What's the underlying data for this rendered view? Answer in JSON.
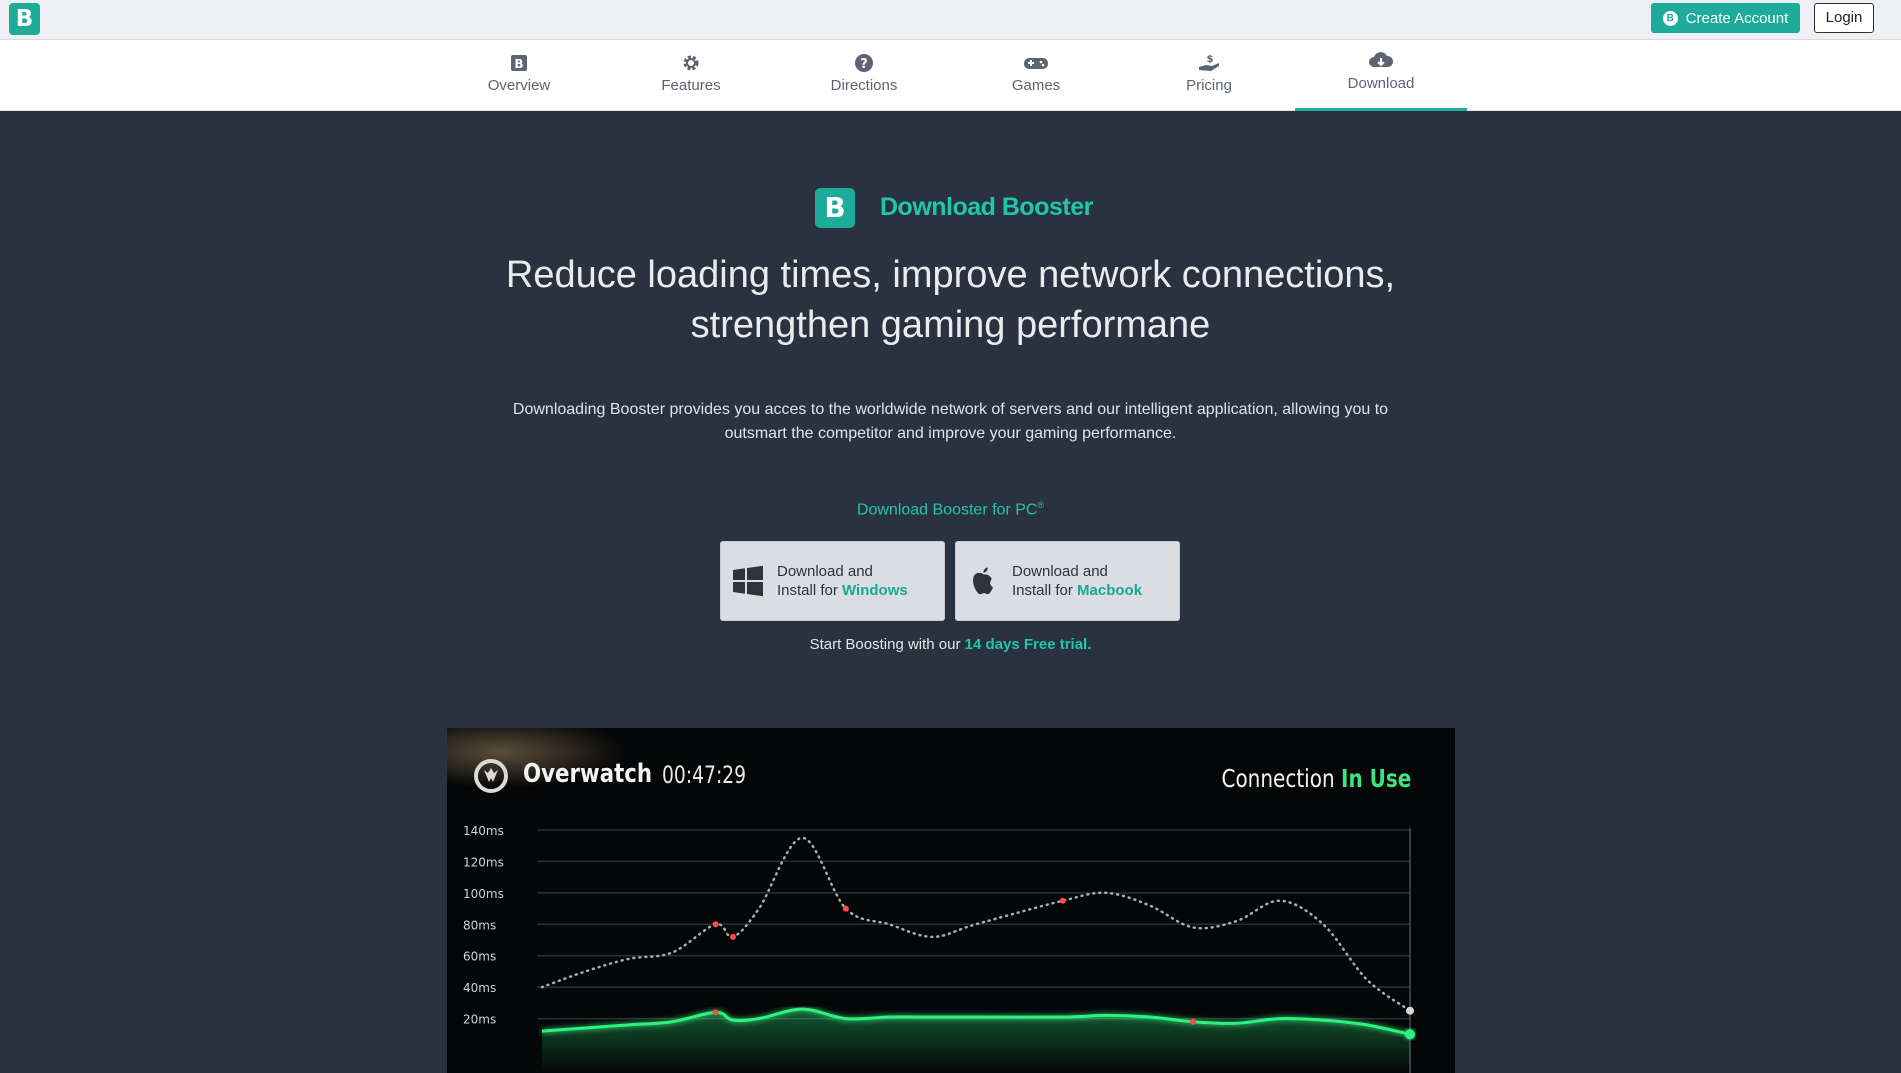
{
  "topbar": {
    "logo_letter": "B",
    "create_account": "Create Account",
    "login": "Login"
  },
  "nav": {
    "items": [
      {
        "label": "Overview",
        "icon": "b-logo-icon"
      },
      {
        "label": "Features",
        "icon": "gear-icon"
      },
      {
        "label": "Directions",
        "icon": "question-icon"
      },
      {
        "label": "Games",
        "icon": "gamepad-icon"
      },
      {
        "label": "Pricing",
        "icon": "dollar-hand-icon"
      },
      {
        "label": "Download",
        "icon": "cloud-download-icon"
      }
    ],
    "active": "Download"
  },
  "hero": {
    "logo_letter": "B",
    "brand": "Download Booster",
    "headline_line1": "Reduce loading times, improve network connections,",
    "headline_line2": "strengthen gaming performane",
    "description": "Downloading Booster provides you acces to the worldwide network of servers and our intelligent application, allowing you to outsmart the competitor and improve your gaming performance.",
    "download_title": "Download Booster for PC",
    "download_title_mark": "®"
  },
  "downloads": {
    "windows": {
      "line1": "Download and",
      "line2_prefix": "Install for ",
      "os": "Windows"
    },
    "mac": {
      "line1": "Download and",
      "line2_prefix": "Install for ",
      "os": "Macbook"
    }
  },
  "trial": {
    "prefix": "Start Boosting with our ",
    "highlight": "14 days Free trial."
  },
  "game_panel": {
    "game": "Overwatch",
    "time": "00:47:29",
    "connection_label": "Connection",
    "connection_status": "In Use"
  },
  "chart_data": {
    "type": "line",
    "y_ticks": [
      "140ms",
      "120ms",
      "100ms",
      "80ms",
      "60ms",
      "40ms",
      "20ms"
    ],
    "ylim": [
      0,
      140
    ],
    "x": [
      0,
      5,
      10,
      15,
      20,
      22,
      25,
      30,
      35,
      40,
      45,
      50,
      60,
      65,
      70,
      75,
      80,
      85,
      90,
      95,
      100
    ],
    "series": [
      {
        "values": [
          40,
          50,
          58,
          62,
          80,
          72,
          90,
          135,
          90,
          80,
          72,
          80,
          95,
          100,
          92,
          78,
          82,
          95,
          80,
          45,
          25
        ]
      },
      {
        "values": [
          12,
          14,
          16,
          18,
          24,
          19,
          20,
          26,
          20,
          21,
          21,
          21,
          21,
          22,
          21,
          18,
          17,
          20,
          19,
          16,
          10
        ]
      }
    ],
    "colors": {
      "baseline": "#a9adb3",
      "booster": "#2ff27f",
      "spike": "#ff4a4a"
    },
    "grid": true,
    "legend": "none"
  }
}
